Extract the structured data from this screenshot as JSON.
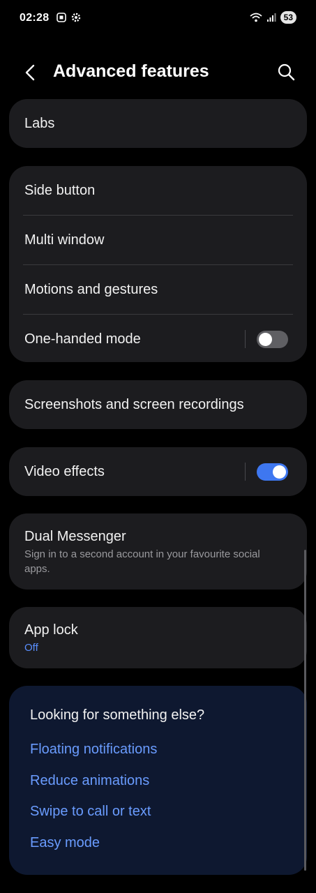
{
  "status_bar": {
    "time": "02:28",
    "battery": "53",
    "icons_left": [
      "screenshot-icon",
      "settings-gear-icon"
    ],
    "icons_right": [
      "wifi-icon",
      "signal-icon",
      "battery-icon"
    ]
  },
  "header": {
    "title": "Advanced features",
    "back_icon": "chevron-left-icon",
    "search_icon": "search-icon"
  },
  "labs": {
    "label": "Labs"
  },
  "group1": {
    "items": [
      {
        "label": "Side button"
      },
      {
        "label": "Multi window"
      },
      {
        "label": "Motions and gestures"
      },
      {
        "label": "One-handed mode",
        "toggle": "off"
      }
    ]
  },
  "screenshots": {
    "label": "Screenshots and screen recordings"
  },
  "video_effects": {
    "label": "Video effects",
    "toggle": "on"
  },
  "dual_messenger": {
    "title": "Dual Messenger",
    "subtitle_line1": "Sign in to a second account in your favourite social",
    "subtitle_line2": "apps."
  },
  "app_lock": {
    "title": "App lock",
    "status": "Off"
  },
  "suggestions": {
    "title": "Looking for something else?",
    "links": [
      "Floating notifications",
      "Reduce animations",
      "Swipe to call or text",
      "Easy mode"
    ]
  },
  "colors": {
    "background": "#000000",
    "card": "#1c1c1f",
    "accent": "#3e77f0",
    "link": "#6a9cff",
    "suggest_card": "#0e1830"
  }
}
